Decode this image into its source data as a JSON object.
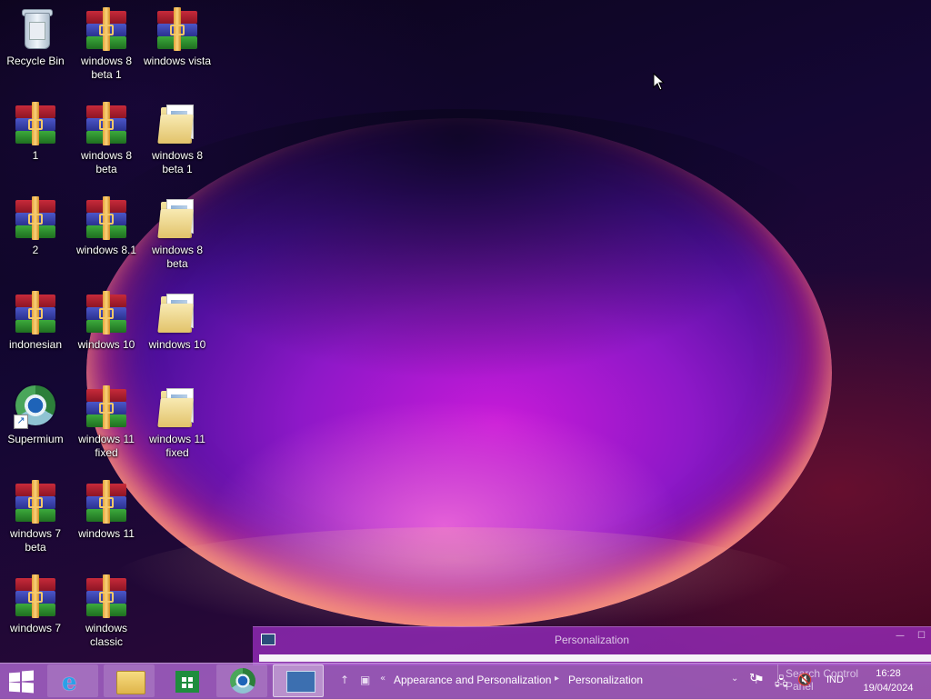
{
  "desktop": {
    "icons": [
      {
        "label": "Recycle Bin",
        "type": "recycle-bin"
      },
      {
        "label": "windows 8 beta 1",
        "type": "archive"
      },
      {
        "label": "windows vista",
        "type": "archive"
      },
      {
        "label": "1",
        "type": "archive"
      },
      {
        "label": "windows 8 beta",
        "type": "archive"
      },
      {
        "label": "windows 8 beta 1",
        "type": "folder"
      },
      {
        "label": "2",
        "type": "archive"
      },
      {
        "label": "windows 8.1",
        "type": "archive"
      },
      {
        "label": "windows 8 beta",
        "type": "folder"
      },
      {
        "label": "indonesian",
        "type": "archive"
      },
      {
        "label": "windows 10",
        "type": "archive"
      },
      {
        "label": "windows 10",
        "type": "folder"
      },
      {
        "label": "Supermium",
        "type": "browser-shortcut"
      },
      {
        "label": "windows 11 fixed",
        "type": "archive"
      },
      {
        "label": "windows 11 fixed",
        "type": "folder"
      },
      {
        "label": "windows 7 beta",
        "type": "archive"
      },
      {
        "label": "windows 11",
        "type": "archive"
      },
      {
        "label": "windows 7",
        "type": "archive"
      },
      {
        "label": "windows classic",
        "type": "archive"
      }
    ]
  },
  "window": {
    "title": "Personalization"
  },
  "taskbar": {
    "buttons": [
      "start-icon",
      "ie-icon",
      "file-explorer-icon",
      "store-icon",
      "supermium-icon",
      "control-panel-icon"
    ],
    "breadcrumb": {
      "prefix": "«",
      "item1": "Appearance and Personalization",
      "item2": "Personalization"
    },
    "search_placeholder": "Search Control Panel",
    "tray": {
      "language": "IND",
      "time": "16:28",
      "date": "19/04/2024"
    }
  },
  "colors": {
    "taskbar": "#b26cd6",
    "window_accent": "#9c2ec4"
  }
}
